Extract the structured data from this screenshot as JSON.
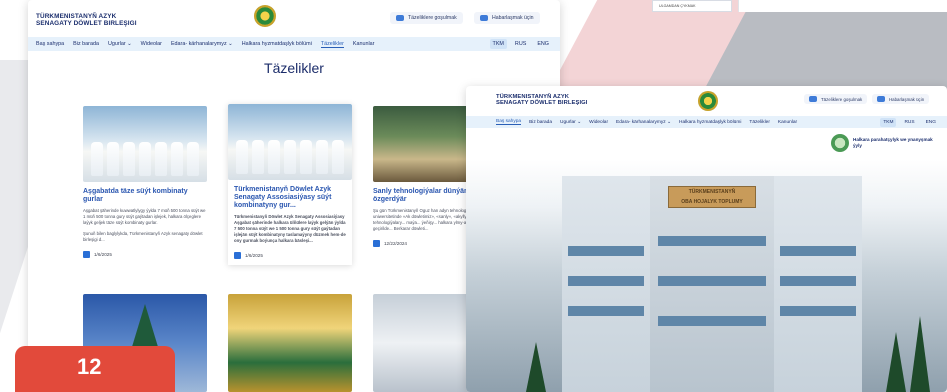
{
  "back_window": {
    "brand": [
      "TÜRKMENISTANYŇ AZYK",
      "SENAGATY DÖWLET BIRLEŞIGI"
    ],
    "header_buttons": [
      "Täzeliklere goşulmak",
      "Habarlaşmak üçin"
    ],
    "nav": [
      "Baş sahypa",
      "Biz barada",
      "Ugurlar ⌄",
      "Wideolar",
      "Edara- kärhanalarymyz ⌄",
      "Halkara hyzmatdaşlyk bölümi",
      "Täzelikler",
      "Kanunlar"
    ],
    "active_nav": "Täzelikler",
    "languages": [
      "TKM",
      "RUS",
      "ENG"
    ],
    "selected_language": "TKM",
    "section_title": "Täzelikler",
    "cards": [
      {
        "title": "Aşgabatda täze süýt kombinaty gurlar",
        "text": "Aşgabat şäherinde kuwwatlylygy ýylda 7 müň 500 tonna süýt we 1 müň 500 tonna gury süýt gaýtadan işlejek, halkara ölçeglere laýyk geljek täze süýt kombinaty gurlar.",
        "text2": "Şunuň bilen baglylykda, Türkmenistanyň Azyk senagaty döwlet birleşigi d...",
        "date": "1/6/2025"
      },
      {
        "title": "Türkmenistanyň Döwlet Azyk Senagaty Assosiasiýasy süýt kombinatyny gur...",
        "text": "Türkmenistanyň Döwlet Azyk Senagaty Assosiasiýasy Aşgabat şäherinde halkara ülňülere laýyk gelýän ýylda 7 500 tonna süýt we 1 500 tonna gury süýt gaýtadan işlejän süýt kombinatyny taslamaýyny düzmek hem-de ony gurmak boýunça halkara bäsleşi...",
        "date": "1/6/2025"
      },
      {
        "title": "Sanly tehnologiýalar dünýäni özgerdýär",
        "text": "Şu gün Türkmenistanyň Oguz han adyn tehnologiýalar uniwersitetinde «Ak döwletimiz», «sanly», «akylly» we tehnologiýalary... maýa... ýeňişy... halkara ylmy-amaly maslahat geçirilde... Berkarar döwleti...",
        "date": "12/22/2024"
      }
    ]
  },
  "front_window": {
    "brand": [
      "TÜRKMENISTANYŇ AZYK",
      "SENAGATY DÖWLET BIRLEŞIGI"
    ],
    "header_buttons": [
      "Täzeliklere goşulmak",
      "Habarlaşmak üçin"
    ],
    "nav": [
      "Baş sahypa",
      "Biz barada",
      "Ugurlar ⌄",
      "Wideolar",
      "Edara- kärhanalarymyz ⌄",
      "Halkara hyzmatdaşlyk bölümi",
      "Täzelikler",
      "Kanunlar"
    ],
    "active_nav": "Baş sahypa",
    "languages": [
      "TKM",
      "RUS",
      "ENG"
    ],
    "selected_language": "TKM",
    "hero_note": "Halkara parahatçylyk we ynanyşmak ýyly",
    "building_sign": [
      "TÜRKMENISTANYŇ",
      "OBA HOJALYK TOPLUMY"
    ]
  },
  "fragment_menu_label": "ULGAMDAN ÇYKMAK",
  "page_number": "12",
  "colors": {
    "nav_bg": "#e6f1fb",
    "title_blue": "#2a56b0",
    "brand_navy": "#1c2f6e",
    "badge_red": "#e24a3b"
  }
}
